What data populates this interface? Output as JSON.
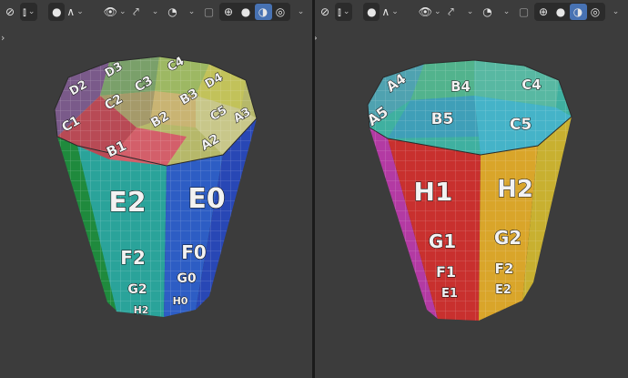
{
  "viewports": [
    {
      "id": "left",
      "expand_arrow": "›",
      "header_icons": [
        "mode-icon",
        "transform-pivot-icon",
        "snap-icon",
        "proportional-edit-icon",
        "visibility-icon",
        "gizmo-icon",
        "overlay-icon",
        "xray-icon",
        "wireframe-icon",
        "solid-icon",
        "material-preview-icon",
        "rendered-icon"
      ],
      "active_shading": "material-preview",
      "top_labels": [
        "D2",
        "D3",
        "C4",
        "D4",
        "C2",
        "C3",
        "B3",
        "C5",
        "C1",
        "B2",
        "A3",
        "B1",
        "A2"
      ],
      "side_labels": [
        "E2",
        "E0",
        "F2",
        "F0",
        "G2",
        "G0",
        "H2",
        "H0"
      ]
    },
    {
      "id": "right",
      "expand_arrow": "‹›",
      "header_icons": [
        "mode-icon",
        "transform-pivot-icon",
        "snap-icon",
        "proportional-edit-icon",
        "visibility-icon",
        "gizmo-icon",
        "overlay-icon",
        "xray-icon",
        "wireframe-icon",
        "solid-icon",
        "material-preview-icon",
        "rendered-icon"
      ],
      "active_shading": "material-preview",
      "top_labels": [
        "B4",
        "C4",
        "A4",
        "B5",
        "A5",
        "C5"
      ],
      "side_labels": [
        "H1",
        "H2",
        "G1",
        "G2",
        "F1",
        "F2",
        "E1",
        "E2"
      ]
    }
  ],
  "colors": {
    "viewport_bg": "#3c3c3c",
    "header_btn_bg": "#2b2b2b",
    "active_btn": "#4772b3"
  }
}
